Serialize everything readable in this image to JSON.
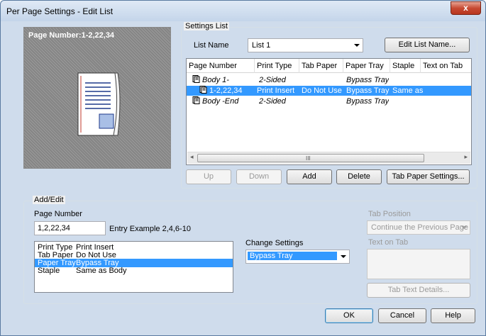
{
  "window": {
    "title": "Per Page Settings - Edit List",
    "close_symbol": "x"
  },
  "preview": {
    "label": "Page Number:1-2,22,34"
  },
  "settings_list": {
    "group_label": "Settings List",
    "list_name_label": "List Name",
    "list_name_value": "List 1",
    "edit_list_name_button": "Edit List Name...",
    "columns": [
      "Page Number",
      "Print Type",
      "Tab Paper",
      "Paper Tray",
      "Staple",
      "Text on Tab"
    ],
    "rows": [
      {
        "page": "Body 1-",
        "print_type": "2-Sided",
        "tab_paper": "",
        "paper_tray": "Bypass Tray",
        "staple": "",
        "text_on_tab": "",
        "selected": false,
        "italic": true
      },
      {
        "page": "1-2,22,34",
        "print_type": "Print Insert",
        "tab_paper": "Do Not Use",
        "paper_tray": "Bypass Tray",
        "staple": "Same as",
        "text_on_tab": "",
        "selected": true,
        "italic": false
      },
      {
        "page": "Body -End",
        "print_type": "2-Sided",
        "tab_paper": "",
        "paper_tray": "Bypass Tray",
        "staple": "",
        "text_on_tab": "",
        "selected": false,
        "italic": true
      }
    ],
    "scroll_grip": "III",
    "scroll_left": "◂",
    "scroll_right": "▸",
    "buttons": {
      "up": "Up",
      "down": "Down",
      "add": "Add",
      "delete": "Delete",
      "tab_paper_settings": "Tab Paper Settings..."
    }
  },
  "add_edit": {
    "group_label": "Add/Edit",
    "page_number_label": "Page Number",
    "page_number_value": "1,2,22,34",
    "entry_example": "Entry Example 2,4,6-10",
    "settings": [
      {
        "key": "Print Type",
        "value": "Print Insert",
        "selected": false
      },
      {
        "key": "Tab Paper",
        "value": "Do Not Use",
        "selected": false
      },
      {
        "key": "Paper Tray",
        "value": "Bypass Tray",
        "selected": true
      },
      {
        "key": "Staple",
        "value": "Same as Body",
        "selected": false
      }
    ],
    "change_settings_label": "Change Settings",
    "change_settings_value": "Bypass Tray",
    "tab_position_label": "Tab Position",
    "tab_position_value": "Continue the Previous Page",
    "text_on_tab_label": "Text on Tab",
    "tab_text_details_button": "Tab Text Details..."
  },
  "footer": {
    "ok": "OK",
    "cancel": "Cancel",
    "help": "Help"
  },
  "colors": {
    "selection": "#3399ff",
    "title_bar": "#c4d5ea",
    "close_button": "#c74a32"
  }
}
